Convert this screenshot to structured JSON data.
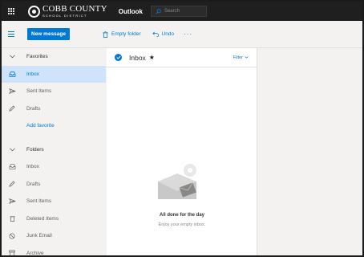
{
  "topbar": {
    "logo_main": "COBB COUNTY",
    "logo_sub": "SCHOOL DISTRICT",
    "app_name": "Outlook",
    "search_placeholder": "Search"
  },
  "toolbar": {
    "new_message": "New message",
    "empty_folder": "Empty folder",
    "undo": "Undo",
    "more": "···"
  },
  "sidebar": {
    "favorites": {
      "label": "Favorites",
      "items": [
        {
          "label": "Inbox",
          "icon": "inbox-icon"
        },
        {
          "label": "Sent Items",
          "icon": "send-icon"
        },
        {
          "label": "Drafts",
          "icon": "pencil-icon"
        }
      ],
      "add_favorite": "Add favorite"
    },
    "folders": {
      "label": "Folders",
      "items": [
        {
          "label": "Inbox",
          "icon": "inbox-icon"
        },
        {
          "label": "Drafts",
          "icon": "pencil-icon"
        },
        {
          "label": "Sent Items",
          "icon": "send-icon"
        },
        {
          "label": "Deleted Items",
          "icon": "trash-icon"
        },
        {
          "label": "Junk Email",
          "icon": "block-icon"
        },
        {
          "label": "Archive",
          "icon": "archive-icon"
        }
      ]
    }
  },
  "list": {
    "title": "Inbox",
    "filter": "Filter",
    "empty_title": "All done for the day",
    "empty_subtitle": "Enjoy your empty inbox."
  },
  "colors": {
    "accent": "#0078d4",
    "topbar": "#1f1f1f",
    "selected": "#cfe4fa"
  }
}
